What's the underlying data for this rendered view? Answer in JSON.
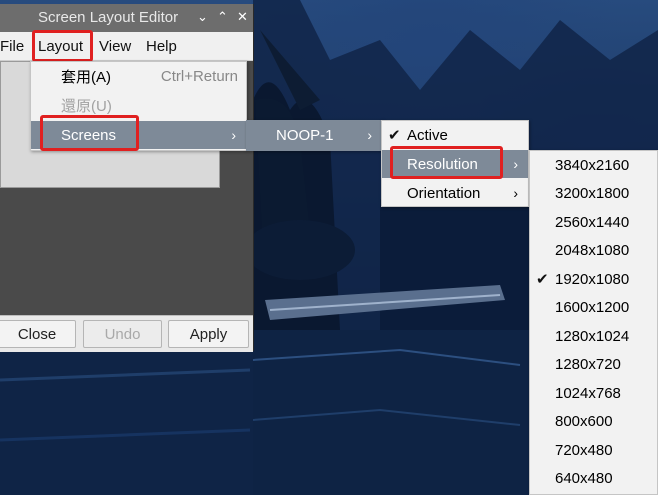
{
  "window": {
    "title": "Screen Layout Editor",
    "controls": [
      "⌄",
      "⌃",
      "✕"
    ]
  },
  "menubar": {
    "items": [
      "File",
      "Layout",
      "View",
      "Help"
    ]
  },
  "layout_menu": {
    "items": [
      {
        "label": "套用(A)",
        "shortcut": "Ctrl+Return"
      },
      {
        "label": "還原(U)",
        "shortcut": ""
      },
      {
        "label": "Screens",
        "shortcut": ""
      }
    ]
  },
  "screens_menu": {
    "items": [
      "NOOP-1"
    ]
  },
  "noop_menu": {
    "active": "Active",
    "resolution": "Resolution",
    "orientation": "Orientation",
    "active_checked": true
  },
  "resolution_menu": {
    "items": [
      "3840x2160",
      "3200x1800",
      "2560x1440",
      "2048x1080",
      "1920x1080",
      "1600x1200",
      "1280x1024",
      "1280x720",
      "1024x768",
      "800x600",
      "720x480",
      "640x480"
    ],
    "selected": "1920x1080"
  },
  "buttons": {
    "close": "Close",
    "undo": "Undo",
    "apply": "Apply"
  },
  "icons": {
    "check": "✔",
    "submenu": "›"
  },
  "colors": {
    "highlight_box": "#e02020",
    "selected_row": "#7e8a98"
  }
}
